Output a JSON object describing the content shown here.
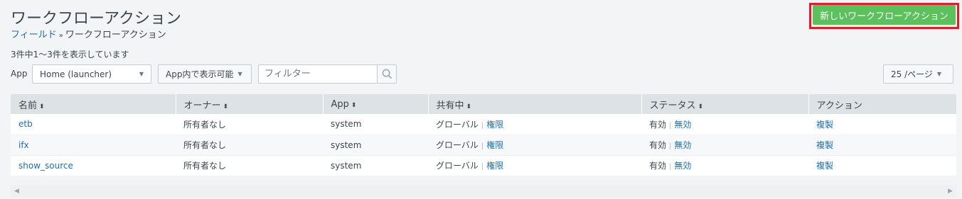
{
  "header": {
    "title": "ワークフローアクション",
    "new_button_label": "新しいワークフローアクション"
  },
  "breadcrumb": {
    "parent": "フィールド",
    "separator": "»",
    "current": "ワークフローアクション"
  },
  "summary": {
    "count_text": "3件中1～3件を表示しています"
  },
  "filters": {
    "app_label": "App",
    "app_select_value": "Home (launcher)",
    "visibility_select_value": "App内で表示可能",
    "filter_placeholder": "フィルター",
    "page_size_value": "25 /ページ"
  },
  "table": {
    "columns": [
      "名前",
      "オーナー",
      "App",
      "共有中",
      "ステータス",
      "アクション"
    ],
    "rows": [
      {
        "name": "etb",
        "owner": "所有者なし",
        "app": "system",
        "sharing": "グローバル",
        "perm_link": "権限",
        "status": "有効",
        "status_link": "無効",
        "action": "複製"
      },
      {
        "name": "ifx",
        "owner": "所有者なし",
        "app": "system",
        "sharing": "グローバル",
        "perm_link": "権限",
        "status": "有効",
        "status_link": "無効",
        "action": "複製"
      },
      {
        "name": "show_source",
        "owner": "所有者なし",
        "app": "system",
        "sharing": "グローバル",
        "perm_link": "権限",
        "status": "有効",
        "status_link": "無効",
        "action": "複製"
      }
    ]
  },
  "colors": {
    "primary_button": "#5cc05c",
    "highlight_outline": "#dd1f2b",
    "link": "#1e6fa8"
  },
  "icons": {
    "search": "search-icon",
    "sort": "sort-icon",
    "caret": "caret-down-icon"
  }
}
